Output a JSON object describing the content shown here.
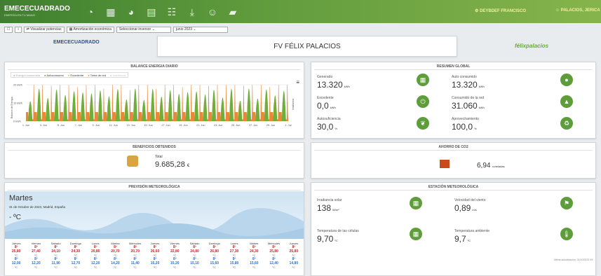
{
  "app": {
    "name": "EMECECUADRADO",
    "tag": "ENERGÍA EN TU MANO",
    "user_link": "DEYBDEF FRANCISCO",
    "plant_link": "PALACIOS, JERICA"
  },
  "toolbar": {
    "btn1": "☐",
    "btn2": "i",
    "inverters": "Visualizar potencias",
    "amort": "Amortización económica",
    "select_inverter": "Seleccionar inversor",
    "month": "junio 2023"
  },
  "header": {
    "logo": "EMECECUADRADO",
    "plant": "FV FÉLIX PALACIOS",
    "brand": "félixpalacios"
  },
  "balance": {
    "title": "BALANCE ENERGIA DIARIO",
    "legend": [
      "Energía consumida",
      "Autoconsumo",
      "Excedente",
      "Toma de red",
      "Irradiancia"
    ],
    "yaxis": [
      "20 kWh",
      "10 kWh",
      "0 kWh"
    ],
    "ytitle": "Balance de Energía",
    "xlabels": [
      "1. Jun",
      "3. Jun",
      "5. Jun",
      "7. Jun",
      "9. Jun",
      "11. Jun",
      "13. Jun",
      "15. Jun",
      "17. Jun",
      "19. Jun",
      "21. Jun",
      "23. Jun",
      "25. Jun",
      "27. Jun",
      "29. Jun",
      "1. Jul"
    ],
    "menu": "≡",
    "right": "Irradiancia"
  },
  "benef": {
    "title": "BENEFICIOS OBTENIDOS",
    "label": "Total",
    "value": "9.685,28",
    "unit": "€"
  },
  "weather": {
    "title": "PREVISIÓN METEOROLÓGICA",
    "day": "Martes",
    "date": "31 de Octubre de 2023, Madrid, España",
    "temp": "- ºC",
    "days": [
      {
        "d": "Jueves",
        "h": "8º",
        "hv": "25,80",
        "l": "8º",
        "lv": "12,00"
      },
      {
        "d": "Viernes",
        "h": "8º",
        "hv": "27,40",
        "l": "8º",
        "lv": "12,20"
      },
      {
        "d": "Sábado",
        "h": "8º",
        "hv": "24,10",
        "l": "8º",
        "lv": "11,90"
      },
      {
        "d": "Domingo",
        "h": "8º",
        "hv": "24,30",
        "l": "8º",
        "lv": "12,70"
      },
      {
        "d": "Lunes",
        "h": "8º",
        "hv": "20,80",
        "l": "8º",
        "lv": "12,20"
      },
      {
        "d": "Martes",
        "h": "8º",
        "hv": "20,70",
        "l": "8º",
        "lv": "14,20"
      },
      {
        "d": "Miércoles",
        "h": "8º",
        "hv": "20,70",
        "l": "8º",
        "lv": "11,40"
      },
      {
        "d": "Jueves",
        "h": "8º",
        "hv": "26,60",
        "l": "8º",
        "lv": "15,20"
      },
      {
        "d": "Viernes",
        "h": "8º",
        "hv": "22,80",
        "l": "8º",
        "lv": "15,20"
      },
      {
        "d": "Sábado",
        "h": "8º",
        "hv": "24,80",
        "l": "8º",
        "lv": "15,10"
      },
      {
        "d": "Domingo",
        "h": "8º",
        "hv": "26,80",
        "l": "8º",
        "lv": "15,60"
      },
      {
        "d": "Lunes",
        "h": "8º",
        "hv": "27,30",
        "l": "8º",
        "lv": "15,80"
      },
      {
        "d": "Martes",
        "h": "8º",
        "hv": "24,30",
        "l": "8º",
        "lv": "15,60"
      },
      {
        "d": "Miércoles",
        "h": "8º",
        "hv": "25,80",
        "l": "8º",
        "lv": "12,40"
      },
      {
        "d": "Jueves",
        "h": "8º",
        "hv": "25,80",
        "l": "8º",
        "lv": "14,80"
      }
    ]
  },
  "resumen": {
    "title": "RESUMEN GLOBAL",
    "items": [
      {
        "label": "Generado",
        "value": "13.320",
        "unit": "kWh",
        "icon": "▦"
      },
      {
        "label": "Auto consumido",
        "value": "13.320",
        "unit": "kWh",
        "icon": "●"
      },
      {
        "label": "Excedente",
        "value": "0,0",
        "unit": "kWh",
        "icon": "⏻"
      },
      {
        "label": "Consumido de la red",
        "value": "31.060",
        "unit": "kWh",
        "icon": "▲"
      },
      {
        "label": "Autosuficiencia",
        "value": "30,0",
        "unit": "%",
        "icon": "❦"
      },
      {
        "label": "Aprovechamiento",
        "value": "100,0",
        "unit": "%",
        "icon": "♻"
      }
    ]
  },
  "ahorro": {
    "title": "AHORRO DE CO2",
    "value": "6,94",
    "unit": "toneladas"
  },
  "estacion": {
    "title": "ESTACIÓN METEOROLÓGICA",
    "items": [
      {
        "label": "Irradiancia solar",
        "value": "138",
        "unit": "W/m²",
        "icon": "▦"
      },
      {
        "label": "Velocidad del viento",
        "value": "0,89",
        "unit": "m/s",
        "icon": "⚑"
      },
      {
        "label": "Temperatura de las células",
        "value": "9,70",
        "unit": "ºC",
        "icon": "▦"
      },
      {
        "label": "Temperatura ambiente",
        "value": "9,7",
        "unit": "ºC",
        "icon": "🌡"
      }
    ],
    "footer": "Última actualización: 31/10/2023 09:"
  },
  "colors": {
    "green": "#5d9d3a",
    "orange": "#e8893a",
    "bar_green": "#6fae3b"
  }
}
